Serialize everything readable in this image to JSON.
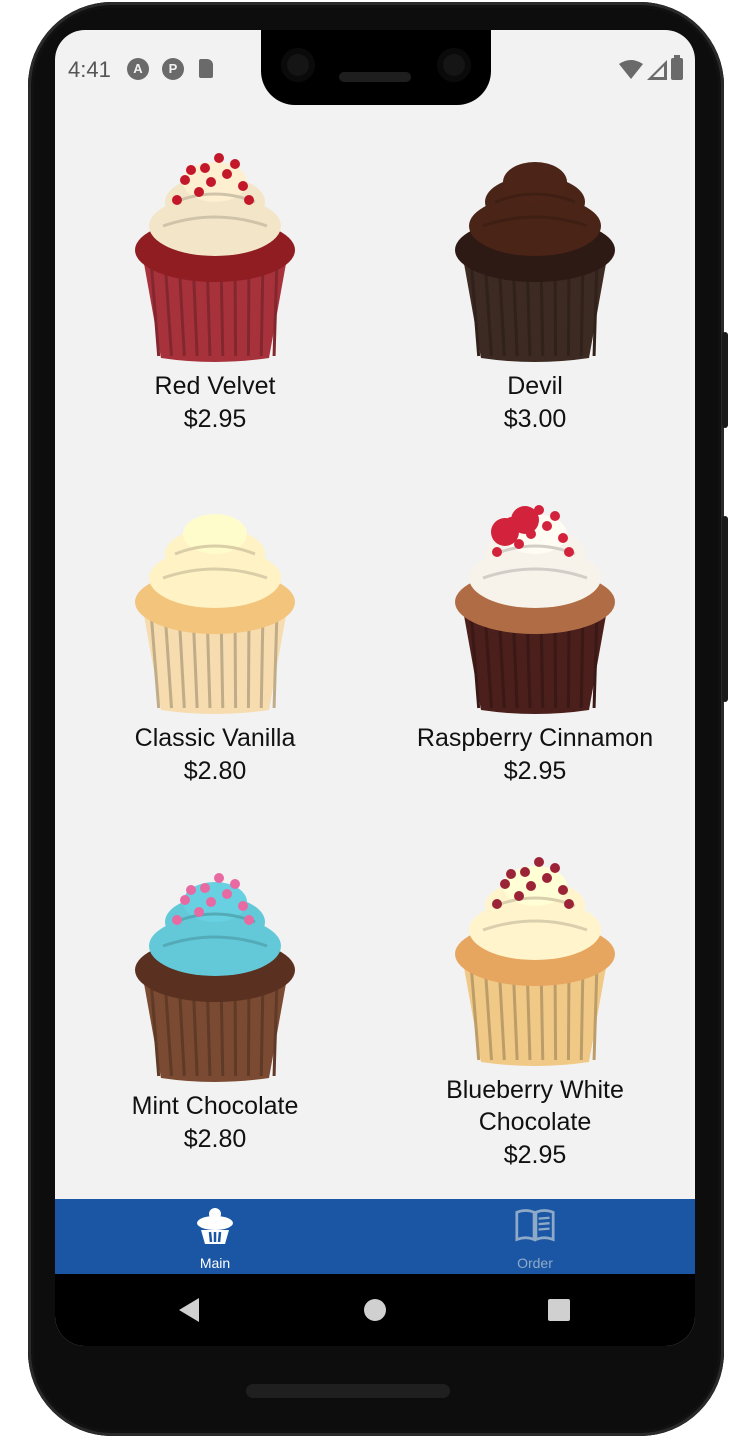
{
  "status_bar": {
    "time": "4:41",
    "icons": [
      "a-notification-icon",
      "p-notification-icon",
      "sd-card-icon",
      "wifi-icon",
      "cell-signal-icon",
      "battery-icon"
    ]
  },
  "products": [
    {
      "name": "Red Velvet",
      "price": "$2.95",
      "frosting": "#f3e6c8",
      "cake": "#8f1d22",
      "wrapper": "#a8323c",
      "topping": "#c3172a"
    },
    {
      "name": "Devil",
      "price": "$3.00",
      "frosting": "#4a2417",
      "cake": "#2e1a14",
      "wrapper": "#3d2a22",
      "topping": ""
    },
    {
      "name": "Classic Vanilla",
      "price": "$2.80",
      "frosting": "#fff2c4",
      "cake": "#f2c47c",
      "wrapper": "#f6dcae",
      "topping": ""
    },
    {
      "name": "Raspberry Cinnamon",
      "price": "$2.95",
      "frosting": "#f7f2ea",
      "cake": "#b06d45",
      "wrapper": "#4a1f1c",
      "topping": "#d3223c"
    },
    {
      "name": "Mint Chocolate",
      "price": "$2.80",
      "frosting": "#63c9d8",
      "cake": "#5a3020",
      "wrapper": "#7a4a32",
      "topping": "#e86aa2"
    },
    {
      "name": "Blueberry White Chocolate",
      "price": "$2.95",
      "frosting": "#fff4cc",
      "cake": "#e7a660",
      "wrapper": "#f1c987",
      "topping": "#9b2338"
    }
  ],
  "tabs": [
    {
      "label": "Main",
      "icon": "cupcake-icon",
      "active": true
    },
    {
      "label": "Order",
      "icon": "open-book-icon",
      "active": false
    }
  ],
  "colors": {
    "tab_bar": "#1a56a3",
    "screen_bg": "#f2f2f2"
  }
}
